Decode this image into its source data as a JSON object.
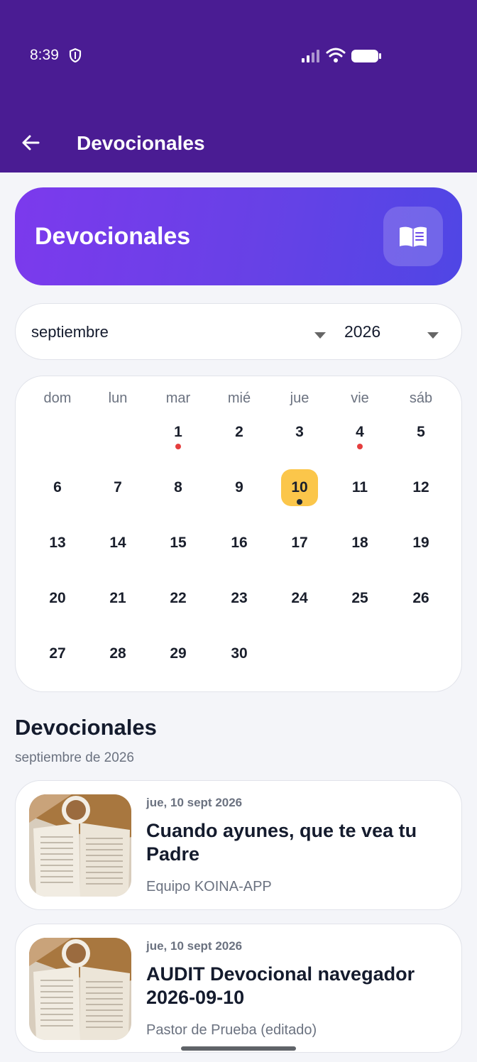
{
  "status_bar": {
    "time": "8:39"
  },
  "app_bar": {
    "title": "Devocionales"
  },
  "hero": {
    "title": "Devocionales",
    "icon": "book-icon"
  },
  "selector": {
    "month": "septiembre",
    "year": "2026"
  },
  "calendar": {
    "weekdays": [
      "dom",
      "lun",
      "mar",
      "mié",
      "jue",
      "vie",
      "sáb"
    ],
    "first_weekday_index": 2,
    "days_in_month": 30,
    "selected_day": 10,
    "days_with_red_dot": [
      1,
      4
    ],
    "days_with_dark_dot": [
      10
    ],
    "colors": {
      "selected_bg": "#fbc64a",
      "red_dot": "#e53e3e",
      "dark_dot": "#1f2937"
    }
  },
  "section": {
    "title": "Devocionales",
    "subtitle": "septiembre de 2026"
  },
  "items": [
    {
      "date": "jue, 10 sept 2026",
      "title": "Cuando ayunes, que te vea tu Padre",
      "author": "Equipo KOINA-APP"
    },
    {
      "date": "jue, 10 sept 2026",
      "title": "AUDIT Devocional navegador 2026-09-10",
      "author": "Pastor de Prueba (editado)"
    }
  ],
  "theme": {
    "top_bar": "#4a1c93",
    "hero_gradient_start": "#7c3aed",
    "hero_gradient_end": "#4f46e5"
  }
}
